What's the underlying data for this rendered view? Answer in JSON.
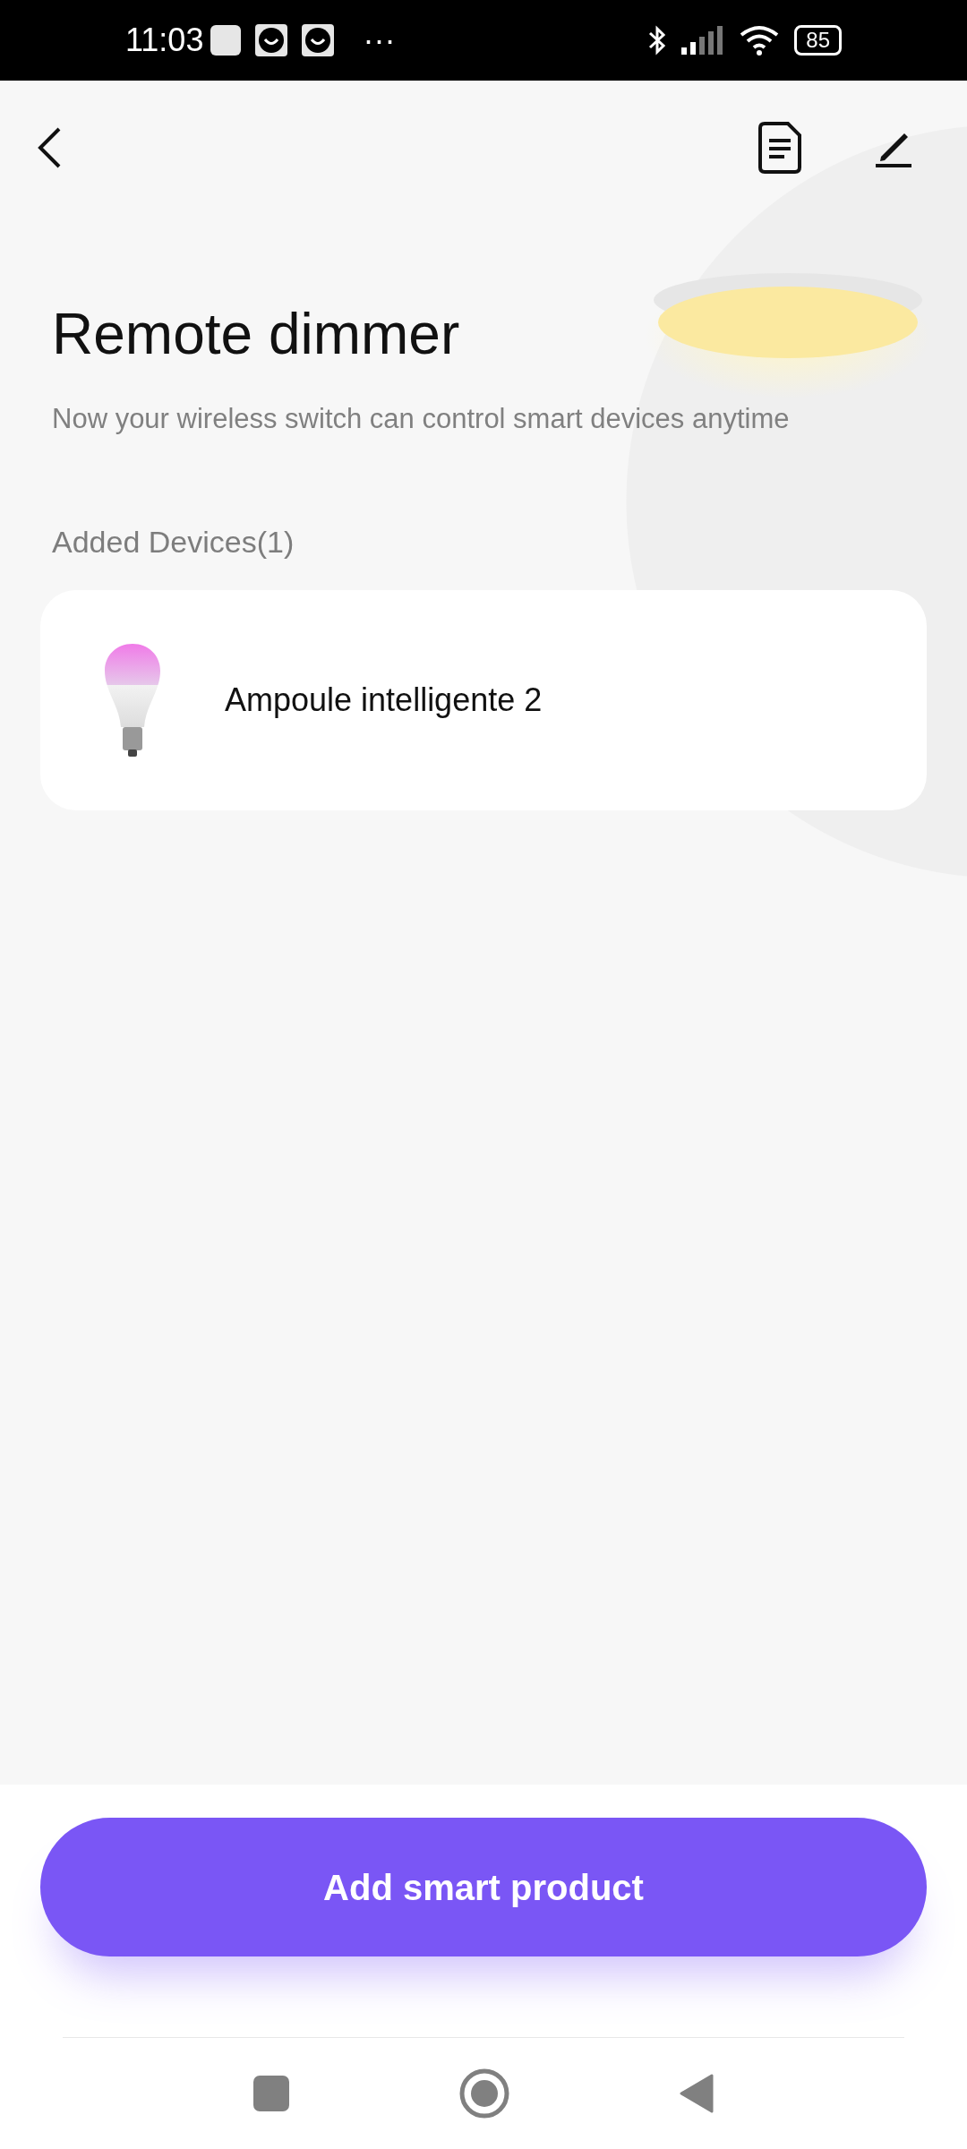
{
  "status_bar": {
    "time": "11:03",
    "more": "···",
    "battery": "85"
  },
  "title": "Remote dimmer",
  "subtitle": "Now your wireless switch can control smart devices anytime",
  "section_label": "Added Devices(1)",
  "devices": [
    {
      "name": "Ampoule intelligente 2"
    }
  ],
  "primary_button": "Add smart product"
}
